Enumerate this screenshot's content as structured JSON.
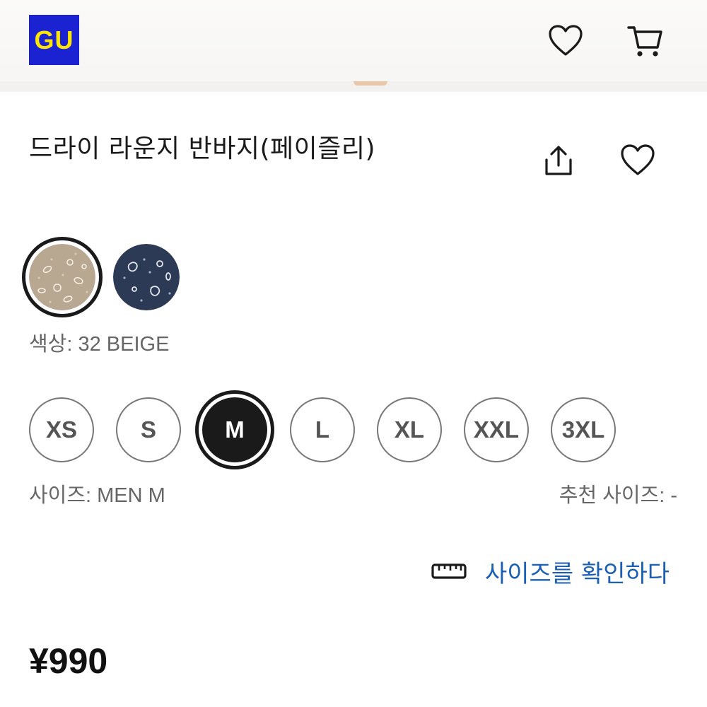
{
  "header": {
    "logo_text": "GU",
    "logo_bg": "#1b22d2",
    "logo_fg": "#ffe600",
    "icons": [
      "heart-icon",
      "cart-icon"
    ]
  },
  "product": {
    "title": "드라이 라운지 반바지(페이즐리)",
    "actions": [
      "share-icon",
      "heart-icon"
    ],
    "colors": [
      {
        "name": "32 BEIGE",
        "hex": "#b8a892",
        "selected": true
      },
      {
        "name": "navy",
        "hex": "#2c3a55",
        "selected": false
      }
    ],
    "color_label": "색상: 32 BEIGE",
    "sizes": [
      {
        "label": "XS",
        "selected": false
      },
      {
        "label": "S",
        "selected": false
      },
      {
        "label": "M",
        "selected": true
      },
      {
        "label": "L",
        "selected": false
      },
      {
        "label": "XL",
        "selected": false
      },
      {
        "label": "XXL",
        "selected": false
      },
      {
        "label": "3XL",
        "selected": false
      }
    ],
    "size_label": "사이즈: MEN M",
    "recommended_size_label": "추천 사이즈: -",
    "check_size_link": "사이즈를 확인하다",
    "link_color": "#1a5fb4",
    "price": "¥990"
  }
}
